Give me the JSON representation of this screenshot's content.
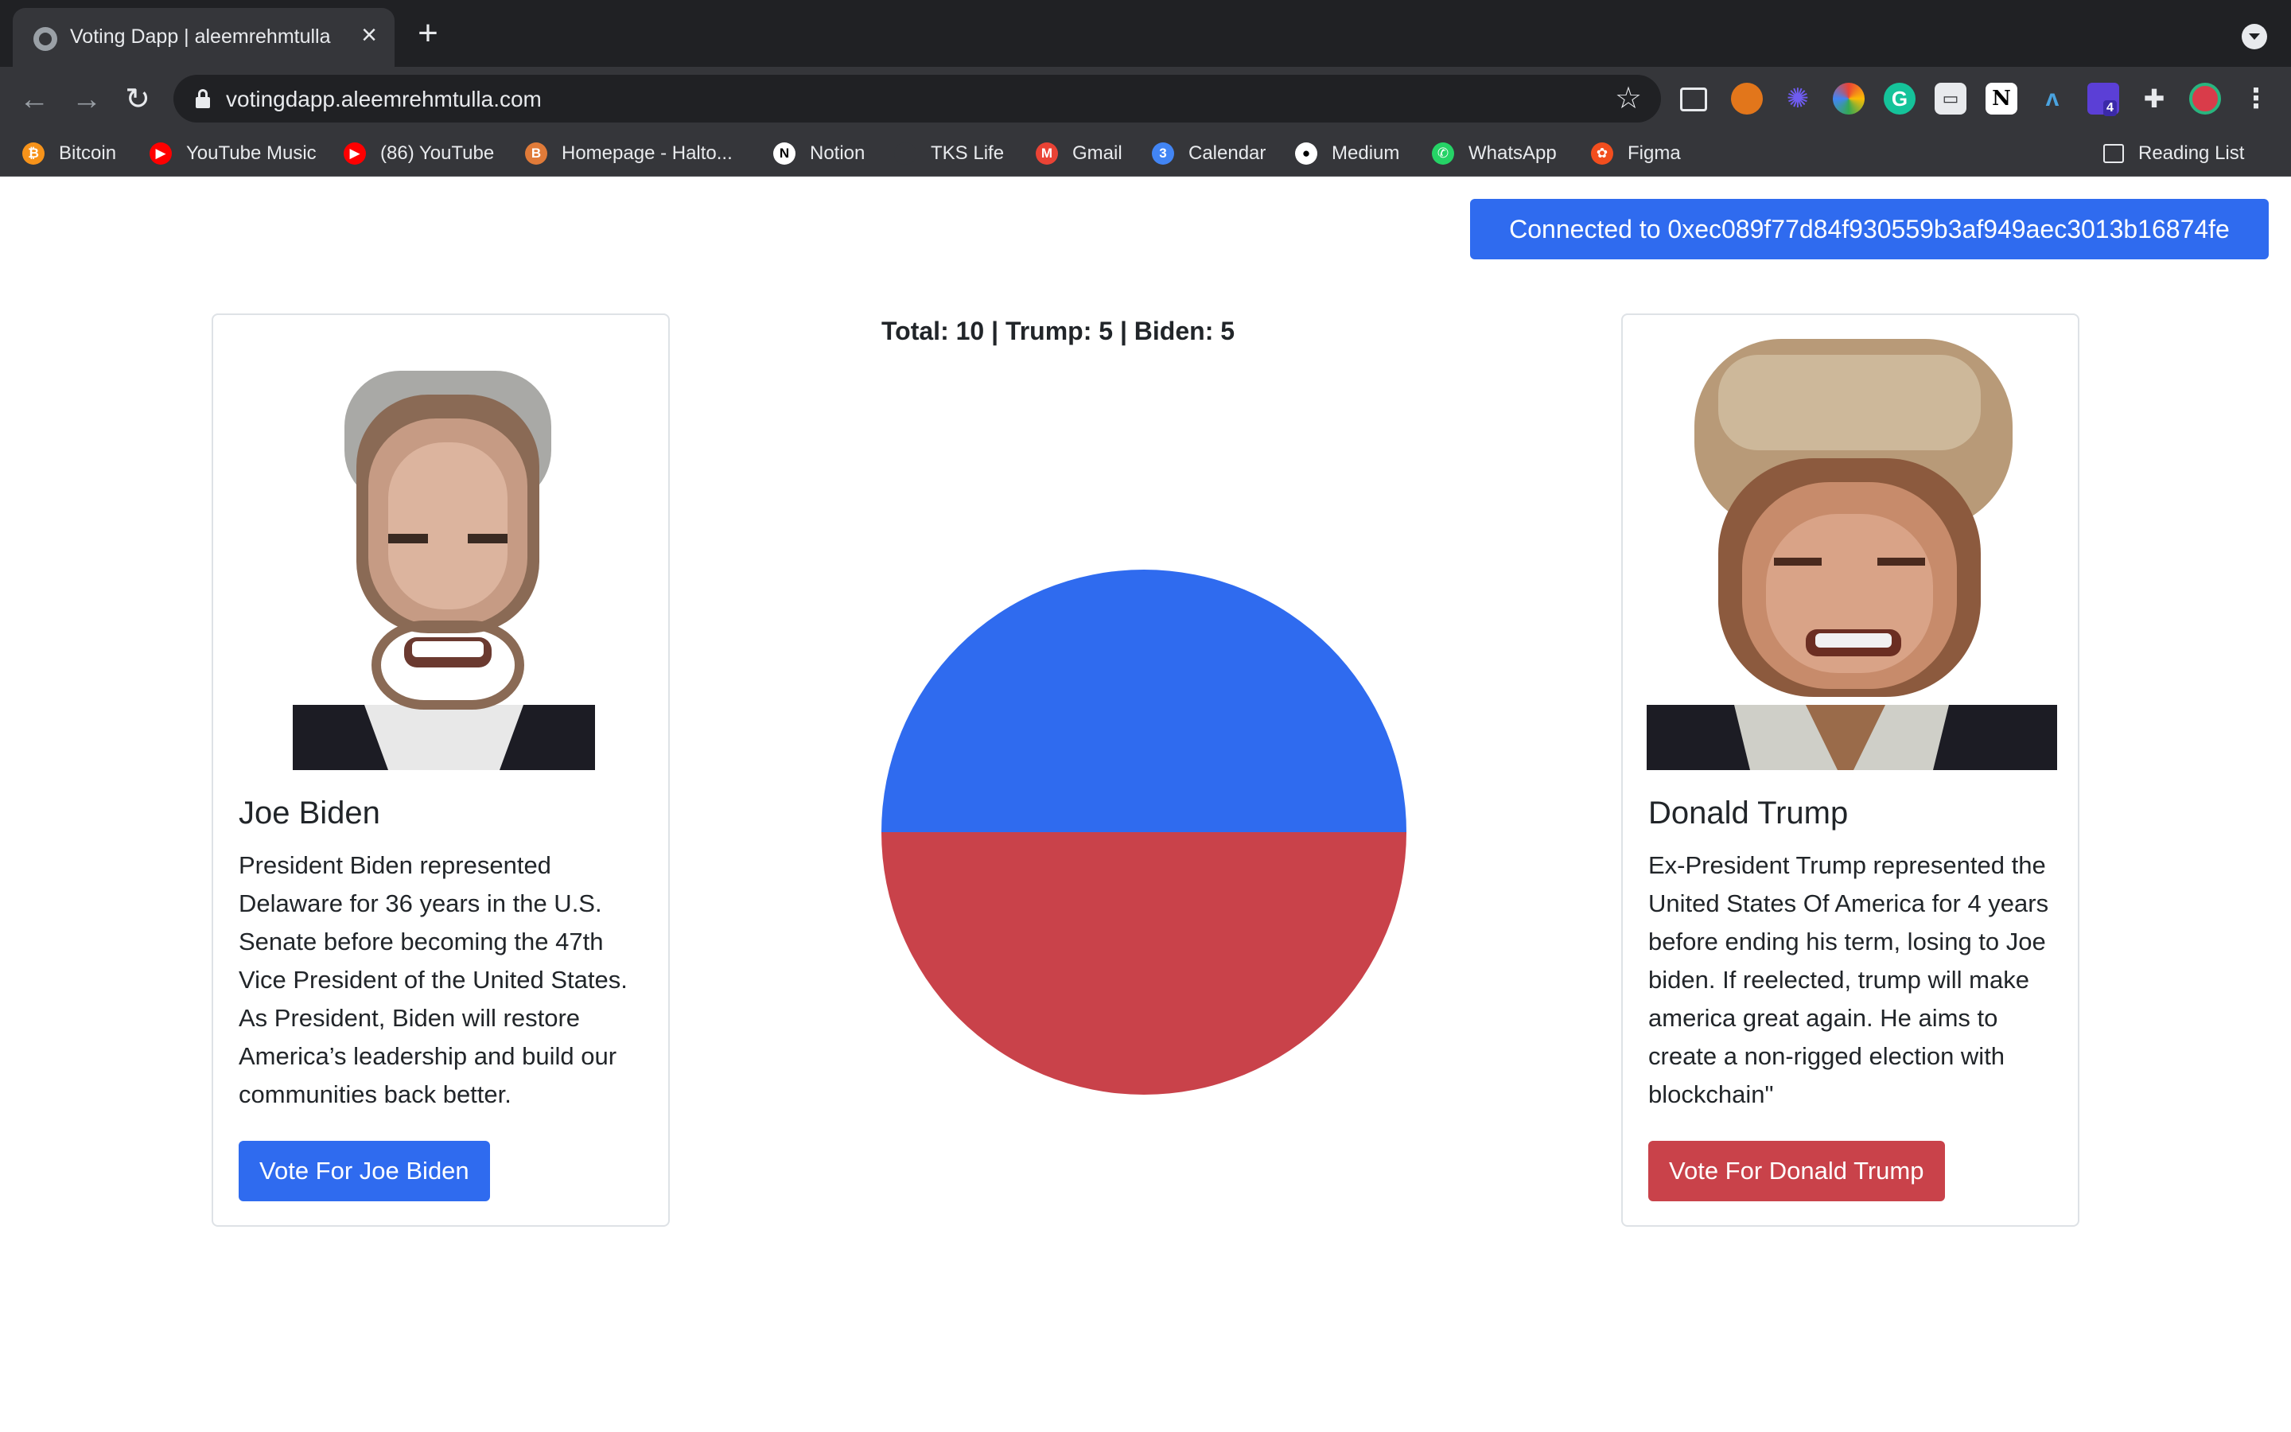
{
  "browser": {
    "tab": {
      "title": "Voting Dapp | aleemrehmtulla"
    },
    "url": "votingdapp.aleemrehmtulla.com",
    "bookmarks": [
      {
        "label": "Bitcoin",
        "color": "#f7931a"
      },
      {
        "label": "YouTube Music",
        "color": "#ff0000"
      },
      {
        "label": "(86) YouTube",
        "color": "#ff0000"
      },
      {
        "label": "Homepage - Halto...",
        "color": "#e07b39"
      },
      {
        "label": "Notion",
        "color": "#ffffff"
      },
      {
        "label": "TKS Life",
        "color": "#35363a"
      },
      {
        "label": "Gmail",
        "color": "#ea4335"
      },
      {
        "label": "Calendar",
        "color": "#4285f4"
      },
      {
        "label": "Medium",
        "color": "#ffffff"
      },
      {
        "label": "WhatsApp",
        "color": "#25d366"
      },
      {
        "label": "Figma",
        "color": "#f24e1e"
      }
    ],
    "reading_list": "Reading List",
    "extension_badge": "4"
  },
  "page": {
    "connected_label": "Connected to 0xec089f77d84f930559b3af949aec3013b16874fe",
    "tally": "Total: 10 | Trump: 5 | Biden: 5",
    "candidates": [
      {
        "name": "Joe Biden",
        "description": "President Biden represented Delaware for 36 years in the U.S. Senate before becoming the 47th Vice President of the United States. As President, Biden will restore America’s leadership and build our communities back better.",
        "button": "Vote For Joe Biden",
        "color": "#2f6bef"
      },
      {
        "name": "Donald Trump",
        "description": "Ex-President Trump represented the United States Of America for 4 years before ending his term, losing to Joe biden. If reelected, trump will make america great again. He aims to create a non-rigged election with blockchain\"",
        "button": "Vote For Donald Trump",
        "color": "#c9424a"
      }
    ]
  },
  "chart_data": {
    "type": "pie",
    "categories": [
      "Biden",
      "Trump"
    ],
    "values": [
      5,
      5
    ],
    "colors": [
      "#2f6bef",
      "#c9424a"
    ],
    "title": "",
    "legend": "none"
  }
}
